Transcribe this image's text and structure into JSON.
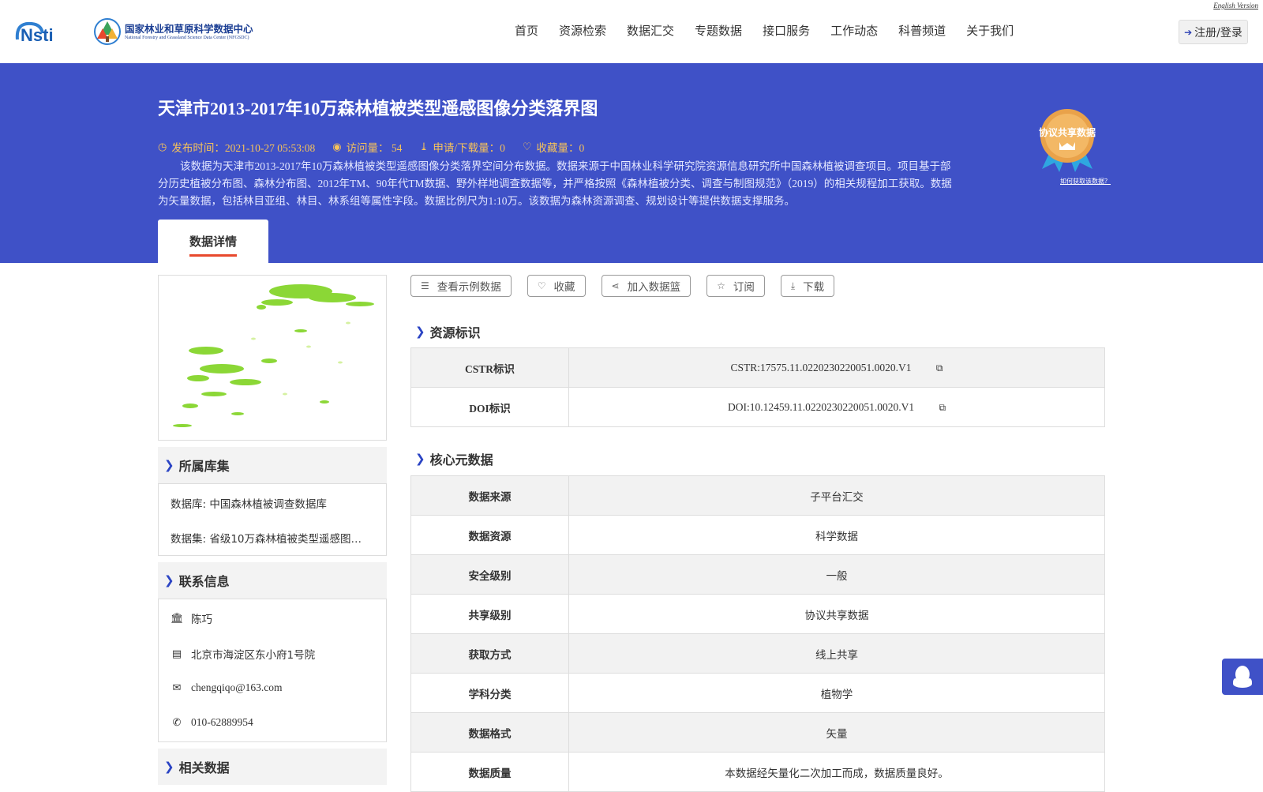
{
  "header": {
    "logo_nsti_text": "Nsti",
    "logo_center_title": "国家林业和草原科学数据中心",
    "logo_center_sub": "National Forestry and Grassland Science Data Center (NFGSDC)",
    "english_version": "English Version",
    "nav": [
      "首页",
      "资源检索",
      "数据汇交",
      "专题数据",
      "接口服务",
      "工作动态",
      "科普频道",
      "关于我们"
    ],
    "login_label": "注册/登录"
  },
  "banner": {
    "title": "天津市2013-2017年10万森林植被类型遥感图像分类落界图",
    "publish": "发布时间：2021-10-27 05:53:08",
    "visits": "访问量： 54",
    "downloads": "申请/下载量：0",
    "favorites": "收藏量：0",
    "description": "该数据为天津市2013-2017年10万森林植被类型遥感图像分类落界空间分布数据。数据来源于中国林业科学研究院资源信息研究所中国森林植被调查项目。项目基于部分历史植被分布图、森林分布图、2012年TM、90年代TM数据、野外样地调查数据等，并严格按照《森林植被分类、调查与制图规范》（2019）的相关规程加工获取。数据为矢量数据，包括林目亚组、林目、林系组等属性字段。数据比例尺为1:10万。该数据为森林资源调查、规划设计等提供数据支撑服务。",
    "badge_text": "协议共享数据",
    "badge_link": "如何获取该数据？",
    "tab_label": "数据详情"
  },
  "left": {
    "collection_title": "所属库集",
    "database": "数据库: 中国森林植被调查数据库",
    "dataset": "数据集: 省级10万森林植被类型遥感图…",
    "contact_title": "联系信息",
    "contact_name": "陈巧",
    "contact_address": "北京市海淀区东小府1号院",
    "contact_email": "chengqiqo@163.com",
    "contact_phone": "010-62889954",
    "related_title": "相关数据"
  },
  "actions": [
    {
      "label": "查看示例数据",
      "icon": "database-icon"
    },
    {
      "label": "收藏",
      "icon": "heart-icon"
    },
    {
      "label": "加入数据篮",
      "icon": "share-icon"
    },
    {
      "label": "订阅",
      "icon": "star-icon"
    },
    {
      "label": "下载",
      "icon": "download-icon"
    }
  ],
  "resource_id": {
    "title": "资源标识",
    "rows": [
      {
        "key": "CSTR标识",
        "value": "CSTR:17575.11.0220230220051.0020.V1"
      },
      {
        "key": "DOI标识",
        "value": "DOI:10.12459.11.0220230220051.0020.V1"
      }
    ]
  },
  "core_meta": {
    "title": "核心元数据",
    "rows": [
      {
        "key": "数据来源",
        "value": "子平台汇交"
      },
      {
        "key": "数据资源",
        "value": "科学数据"
      },
      {
        "key": "安全级别",
        "value": "一般"
      },
      {
        "key": "共享级别",
        "value": "协议共享数据"
      },
      {
        "key": "获取方式",
        "value": "线上共享"
      },
      {
        "key": "学科分类",
        "value": "植物学"
      },
      {
        "key": "数据格式",
        "value": "矢量"
      },
      {
        "key": "数据质量",
        "value": "本数据经矢量化二次加工而成，数据质量良好。"
      }
    ]
  },
  "colors": {
    "banner": "#3f51c7",
    "accent_gold": "#f7c35a",
    "tab_underline": "#e8492d",
    "chevron": "#2b44c4"
  }
}
